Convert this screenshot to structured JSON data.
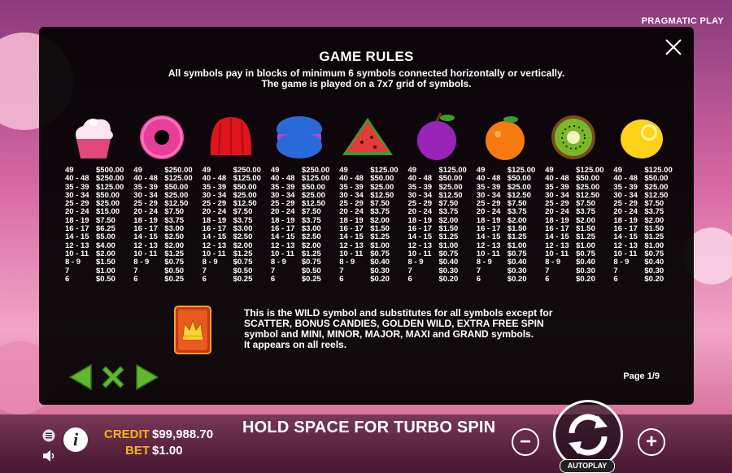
{
  "brand": "PRAGMATIC PLAY",
  "rules": {
    "title": "GAME RULES",
    "subtitle_line1": "All symbols pay in blocks of minimum 6 symbols connected horizontally or vertically.",
    "subtitle_line2": "The game is played on a 7x7 grid of symbols."
  },
  "symbols": [
    {
      "icon": "cupcake-icon",
      "color": "#ff8fb0",
      "pays": [
        [
          "49",
          "$500.00"
        ],
        [
          "40 - 48",
          "$250.00"
        ],
        [
          "35 - 39",
          "$125.00"
        ],
        [
          "30 - 34",
          "$50.00"
        ],
        [
          "25 - 29",
          "$25.00"
        ],
        [
          "20 - 24",
          "$15.00"
        ],
        [
          "18 - 19",
          "$7.50"
        ],
        [
          "16 - 17",
          "$6.25"
        ],
        [
          "14 - 15",
          "$5.00"
        ],
        [
          "12 - 13",
          "$4.00"
        ],
        [
          "10 - 11",
          "$2.00"
        ],
        [
          "8 - 9",
          "$1.50"
        ],
        [
          "7",
          "$1.00"
        ],
        [
          "6",
          "$0.50"
        ]
      ]
    },
    {
      "icon": "donut-icon",
      "color": "#e93d9a",
      "pays": [
        [
          "49",
          "$250.00"
        ],
        [
          "40 - 48",
          "$125.00"
        ],
        [
          "35 - 39",
          "$50.00"
        ],
        [
          "30 - 34",
          "$25.00"
        ],
        [
          "25 - 29",
          "$12.50"
        ],
        [
          "20 - 24",
          "$7.50"
        ],
        [
          "18 - 19",
          "$3.75"
        ],
        [
          "16 - 17",
          "$3.00"
        ],
        [
          "14 - 15",
          "$2.50"
        ],
        [
          "12 - 13",
          "$2.00"
        ],
        [
          "10 - 11",
          "$1.25"
        ],
        [
          "8 - 9",
          "$0.75"
        ],
        [
          "7",
          "$0.50"
        ],
        [
          "6",
          "$0.25"
        ]
      ]
    },
    {
      "icon": "jelly-icon",
      "color": "#e0141c",
      "pays": [
        [
          "49",
          "$250.00"
        ],
        [
          "40 - 48",
          "$125.00"
        ],
        [
          "35 - 39",
          "$50.00"
        ],
        [
          "30 - 34",
          "$25.00"
        ],
        [
          "25 - 29",
          "$12.50"
        ],
        [
          "20 - 24",
          "$7.50"
        ],
        [
          "18 - 19",
          "$3.75"
        ],
        [
          "16 - 17",
          "$3.00"
        ],
        [
          "14 - 15",
          "$2.50"
        ],
        [
          "12 - 13",
          "$2.00"
        ],
        [
          "10 - 11",
          "$1.25"
        ],
        [
          "8 - 9",
          "$0.75"
        ],
        [
          "7",
          "$0.50"
        ],
        [
          "6",
          "$0.25"
        ]
      ]
    },
    {
      "icon": "macaron-icon",
      "color": "#2a6ad8",
      "pays": [
        [
          "49",
          "$250.00"
        ],
        [
          "40 - 48",
          "$125.00"
        ],
        [
          "35 - 39",
          "$50.00"
        ],
        [
          "30 - 34",
          "$25.00"
        ],
        [
          "25 - 29",
          "$12.50"
        ],
        [
          "20 - 24",
          "$7.50"
        ],
        [
          "18 - 19",
          "$3.75"
        ],
        [
          "16 - 17",
          "$3.00"
        ],
        [
          "14 - 15",
          "$2.50"
        ],
        [
          "12 - 13",
          "$2.00"
        ],
        [
          "10 - 11",
          "$1.25"
        ],
        [
          "8 - 9",
          "$0.75"
        ],
        [
          "7",
          "$0.50"
        ],
        [
          "6",
          "$0.25"
        ]
      ]
    },
    {
      "icon": "watermelon-icon",
      "color": "#e63a3a",
      "pays": [
        [
          "49",
          "$125.00"
        ],
        [
          "40 - 48",
          "$50.00"
        ],
        [
          "35 - 39",
          "$25.00"
        ],
        [
          "30 - 34",
          "$12.50"
        ],
        [
          "25 - 29",
          "$7.50"
        ],
        [
          "20 - 24",
          "$3.75"
        ],
        [
          "18 - 19",
          "$2.00"
        ],
        [
          "16 - 17",
          "$1.50"
        ],
        [
          "14 - 15",
          "$1.25"
        ],
        [
          "12 - 13",
          "$1.00"
        ],
        [
          "10 - 11",
          "$0.75"
        ],
        [
          "8 - 9",
          "$0.40"
        ],
        [
          "7",
          "$0.30"
        ],
        [
          "6",
          "$0.20"
        ]
      ]
    },
    {
      "icon": "plum-icon",
      "color": "#9a24b8",
      "pays": [
        [
          "49",
          "$125.00"
        ],
        [
          "40 - 48",
          "$50.00"
        ],
        [
          "35 - 39",
          "$25.00"
        ],
        [
          "30 - 34",
          "$12.50"
        ],
        [
          "25 - 29",
          "$7.50"
        ],
        [
          "20 - 24",
          "$3.75"
        ],
        [
          "18 - 19",
          "$2.00"
        ],
        [
          "16 - 17",
          "$1.50"
        ],
        [
          "14 - 15",
          "$1.25"
        ],
        [
          "12 - 13",
          "$1.00"
        ],
        [
          "10 - 11",
          "$0.75"
        ],
        [
          "8 - 9",
          "$0.40"
        ],
        [
          "7",
          "$0.30"
        ],
        [
          "6",
          "$0.20"
        ]
      ]
    },
    {
      "icon": "orange-icon",
      "color": "#f57a10",
      "pays": [
        [
          "49",
          "$125.00"
        ],
        [
          "40 - 48",
          "$50.00"
        ],
        [
          "35 - 39",
          "$25.00"
        ],
        [
          "30 - 34",
          "$12.50"
        ],
        [
          "25 - 29",
          "$7.50"
        ],
        [
          "20 - 24",
          "$3.75"
        ],
        [
          "18 - 19",
          "$2.00"
        ],
        [
          "16 - 17",
          "$1.50"
        ],
        [
          "14 - 15",
          "$1.25"
        ],
        [
          "12 - 13",
          "$1.00"
        ],
        [
          "10 - 11",
          "$0.75"
        ],
        [
          "8 - 9",
          "$0.40"
        ],
        [
          "7",
          "$0.30"
        ],
        [
          "6",
          "$0.20"
        ]
      ]
    },
    {
      "icon": "kiwi-icon",
      "color": "#7ab82a",
      "pays": [
        [
          "49",
          "$125.00"
        ],
        [
          "40 - 48",
          "$50.00"
        ],
        [
          "35 - 39",
          "$25.00"
        ],
        [
          "30 - 34",
          "$12.50"
        ],
        [
          "25 - 29",
          "$7.50"
        ],
        [
          "20 - 24",
          "$3.75"
        ],
        [
          "18 - 19",
          "$2.00"
        ],
        [
          "16 - 17",
          "$1.50"
        ],
        [
          "14 - 15",
          "$1.25"
        ],
        [
          "12 - 13",
          "$1.00"
        ],
        [
          "10 - 11",
          "$0.75"
        ],
        [
          "8 - 9",
          "$0.40"
        ],
        [
          "7",
          "$0.30"
        ],
        [
          "6",
          "$0.20"
        ]
      ]
    },
    {
      "icon": "lemon-icon",
      "color": "#ffd21a",
      "pays": [
        [
          "49",
          "$125.00"
        ],
        [
          "40 - 48",
          "$50.00"
        ],
        [
          "35 - 39",
          "$25.00"
        ],
        [
          "30 - 34",
          "$12.50"
        ],
        [
          "25 - 29",
          "$7.50"
        ],
        [
          "20 - 24",
          "$3.75"
        ],
        [
          "18 - 19",
          "$2.00"
        ],
        [
          "16 - 17",
          "$1.50"
        ],
        [
          "14 - 15",
          "$1.25"
        ],
        [
          "12 - 13",
          "$1.00"
        ],
        [
          "10 - 11",
          "$0.75"
        ],
        [
          "8 - 9",
          "$0.40"
        ],
        [
          "7",
          "$0.30"
        ],
        [
          "6",
          "$0.20"
        ]
      ]
    }
  ],
  "wild": {
    "icon": "wild-crown-icon",
    "line1": "This is the WILD symbol and substitutes for all symbols except for",
    "line2": "SCATTER, BONUS CANDIES, GOLDEN WILD, EXTRA FREE SPIN",
    "line3": "symbol and MINI, MINOR, MAJOR, MAXI and GRAND symbols.",
    "line4": "It appears on all reels."
  },
  "page_label": "Page 1/9",
  "bottom": {
    "credit_label": "CREDIT",
    "credit_value": "$99,988.70",
    "bet_label": "BET",
    "bet_value": "$1.00",
    "turbo_text": "HOLD SPACE FOR TURBO SPIN",
    "autoplay_label": "AUTOPLAY",
    "minus": "−",
    "plus": "+",
    "info": "i"
  },
  "colors": {
    "accent_gold": "#f7b21a",
    "nav_green": "#62b72e"
  }
}
